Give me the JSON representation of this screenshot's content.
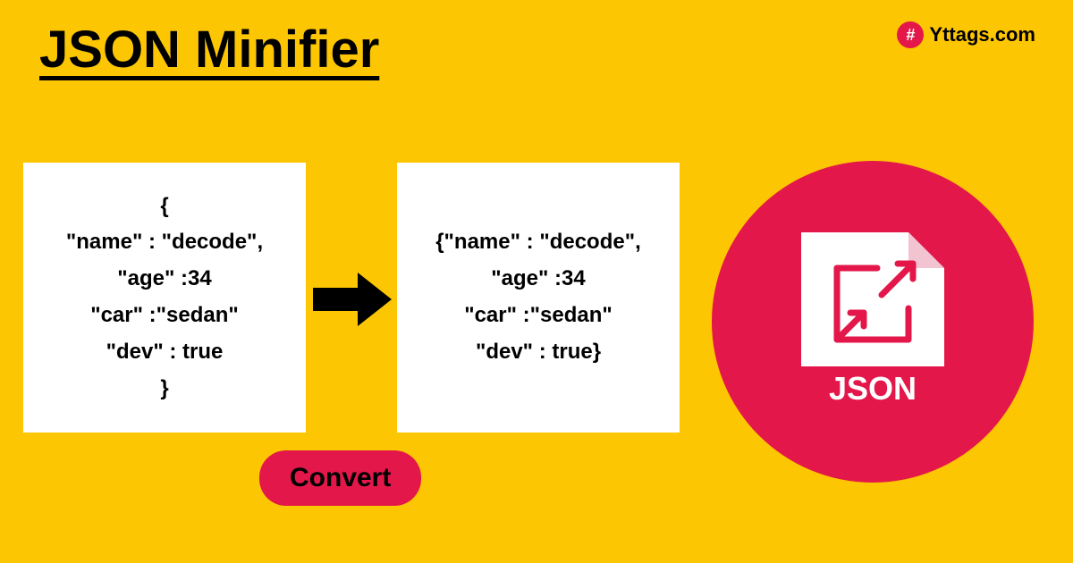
{
  "title": "JSON Minifier",
  "brand": {
    "icon_glyph": "#",
    "text": "Yttags.com"
  },
  "input_panel": {
    "lines": [
      "{",
      "\"name\" : \"decode\",",
      "\"age\" :34",
      "\"car\" :\"sedan\"",
      "\"dev\" : true",
      "}"
    ]
  },
  "output_panel": {
    "lines": [
      "{\"name\" : \"decode\",",
      "\"age\" :34",
      "\"car\" :\"sedan\"",
      "\"dev\" : true}"
    ]
  },
  "convert_button": "Convert",
  "json_badge_label": "JSON",
  "colors": {
    "background": "#fdc602",
    "accent": "#e3174a",
    "panel": "#ffffff",
    "text": "#000000"
  }
}
